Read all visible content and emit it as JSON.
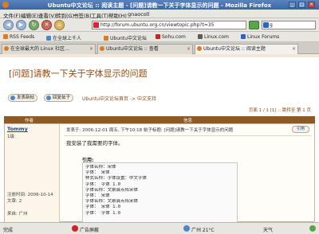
{
  "window": {
    "title": "Ubuntu中文论坛 :: 阅读主题 - [问题]请教一下关于字体显示的问题 - Mozilla Firefox",
    "min_label": "_",
    "max_label": "□",
    "close_label": "×"
  },
  "menu": {
    "items": [
      "文件(F)",
      "编辑(E)",
      "查看(V)",
      "转到(G)",
      "书签(B)",
      "工具(T)",
      "帮助(H)",
      "gnaocoll"
    ]
  },
  "nav": {
    "back_glyph": "◀",
    "forward_glyph": "▶",
    "reload_glyph": "↻",
    "stop_glyph": "✕",
    "home_glyph": "⌂",
    "url": "http://forum.ubuntu.org.cn/viewtopic.php?t=35",
    "search_value": "g"
  },
  "bookmarks": [
    {
      "label": "RSS Feeds",
      "color": "#e07a1f"
    },
    {
      "label": "在全球上千人",
      "color": "#4f86c6"
    },
    {
      "label": "Ubuntu中文论坛",
      "color": "#e07a1f"
    },
    {
      "label": "Sohu.com",
      "color": "#c22"
    },
    {
      "label": "Linux.com",
      "color": "#5b5b5b"
    },
    {
      "label": "Linux Forums",
      "color": "#2a62c9"
    }
  ],
  "tabs": [
    {
      "label": "在全球最大的 Linux 社区…"
    },
    {
      "label": "Ubuntu中文论坛 :: 查看"
    },
    {
      "label": "Ubuntu中文论坛 :: 阅读主题"
    }
  ],
  "page": {
    "title": "[问题]请教一下关于字体显示的问题",
    "new_topic_label": "发表新帖",
    "reply_label": "回复帖子",
    "breadcrumb": "Ubuntu中文论坛首页 -> 中文支持",
    "pager": "页面 1 / 1 [1] :: 跳转至 第 1 页",
    "col_author": "作者",
    "col_message": "信息"
  },
  "post": {
    "author": "Tommy",
    "rank": "1级",
    "joined": "注册时间: 2006-10-14",
    "posts": "文章: 2",
    "from": "来自: 广州",
    "header": "发表于: 2006-12-01 周五, 下午10:18    帖子标题: [问题]请教一下关于字体显示的问题",
    "quote_button": "引用",
    "text": "我安装了我需要的字体。",
    "quote_label": "引用:",
    "quote_lines": [
      "字体名称：宋体",
      "字体：  宋体",
      "样式名称：字体设置：中文字体",
      "字体：  字体 1.0",
      "字体名称：文泉驿点阵宋体",
      "字体：  宋体",
      "字体名称：文泉驿点阵宋体",
      "字体：  宋体 1.0",
      "字体：  字体 1.0"
    ]
  },
  "status": {
    "done": "完成",
    "adblock": "广告屏蔽",
    "weather": "广州 21°C",
    "misc": "天气"
  }
}
